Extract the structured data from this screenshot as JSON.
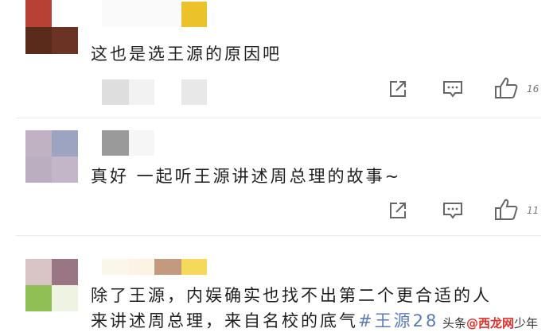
{
  "comments": [
    {
      "text": "这也是选王源的原因吧",
      "actions": {
        "share_icon": "share-icon",
        "reply_icon": "comment-icon",
        "like_icon": "thumbs-up-icon",
        "likes": "16"
      }
    },
    {
      "text": "真好 一起听王源讲述周总理的故事~",
      "actions": {
        "share_icon": "share-icon",
        "reply_icon": "comment-icon",
        "like_icon": "thumbs-up-icon",
        "likes": "11"
      }
    },
    {
      "text_line1": "除了王源，内娱确实也找不出第二个更合适的人",
      "text_line2_prefix": "来讲述周总理，来自名校的底气",
      "hashtag": "#王源28"
    }
  ],
  "watermark": {
    "left": "头条",
    "logo": "@西龙网",
    "right": "少年"
  },
  "colors": {
    "hashtag": "#5b7bb5",
    "watermark_logo": "#e0322b"
  }
}
